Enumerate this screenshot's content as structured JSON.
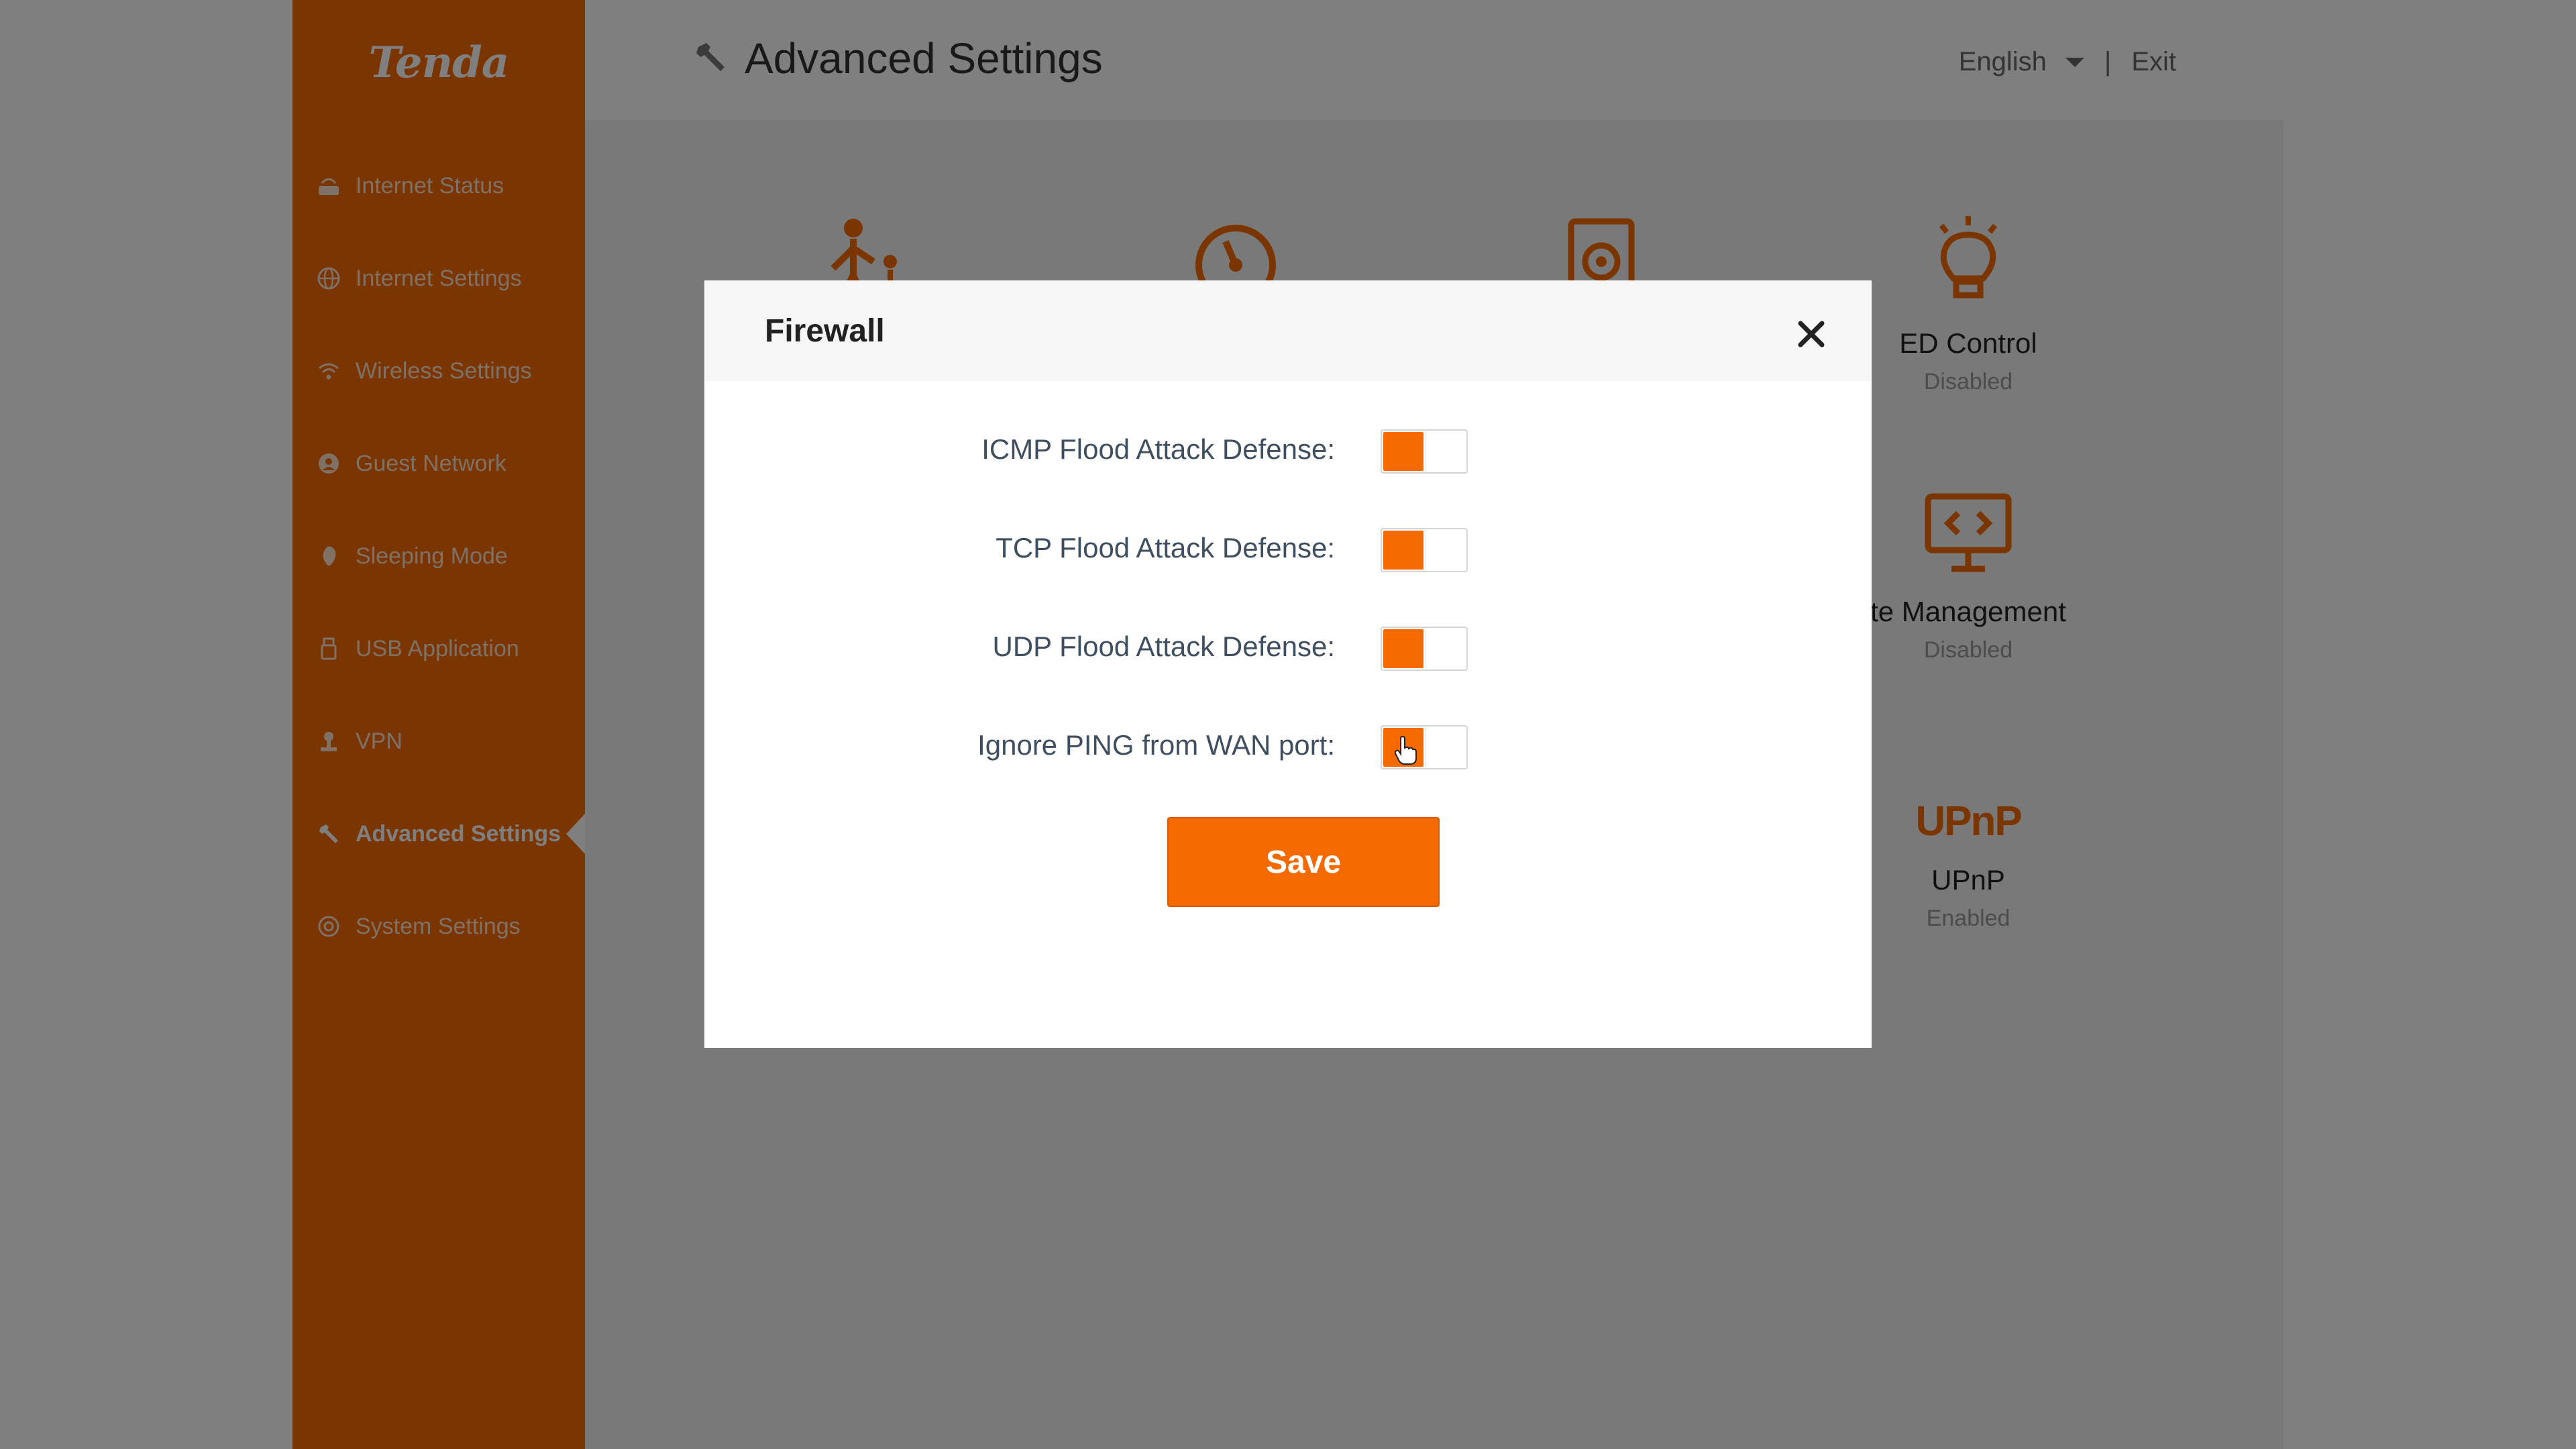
{
  "app": {
    "logo": "Tenda",
    "colors": {
      "brand": "#f56a00",
      "overlay": "rgba(0,0,0,0.5)"
    }
  },
  "sidebar": {
    "items": [
      {
        "label": "Internet Status",
        "icon": "router-icon"
      },
      {
        "label": "Internet Settings",
        "icon": "globe-icon"
      },
      {
        "label": "Wireless Settings",
        "icon": "wifi-icon"
      },
      {
        "label": "Guest Network",
        "icon": "guest-network-icon"
      },
      {
        "label": "Sleeping Mode",
        "icon": "moon-icon"
      },
      {
        "label": "USB Application",
        "icon": "usb-icon"
      },
      {
        "label": "VPN",
        "icon": "vpn-icon"
      },
      {
        "label": "Advanced Settings",
        "icon": "wrench-icon",
        "active": true
      },
      {
        "label": "System Settings",
        "icon": "gear-icon"
      }
    ]
  },
  "header": {
    "title": "Advanced Settings",
    "language": "English",
    "separator": "|",
    "exit": "Exit"
  },
  "tiles": [
    {
      "name": "ED Control",
      "status": "Disabled",
      "icon": "lightbulb-icon"
    },
    {
      "name": "te Management",
      "status": "Disabled",
      "icon": "monitor-code-icon"
    },
    {
      "name": "UPnP",
      "status": "Enabled",
      "icon": "upnp-icon",
      "glyph": "UPnP"
    }
  ],
  "modal": {
    "title": "Firewall",
    "rows": [
      {
        "label": "ICMP Flood Attack Defense:",
        "enabled": true
      },
      {
        "label": "TCP Flood Attack Defense:",
        "enabled": true
      },
      {
        "label": "UDP Flood Attack Defense:",
        "enabled": true
      },
      {
        "label": "Ignore PING from WAN port:",
        "enabled": true
      }
    ],
    "save_label": "Save"
  }
}
